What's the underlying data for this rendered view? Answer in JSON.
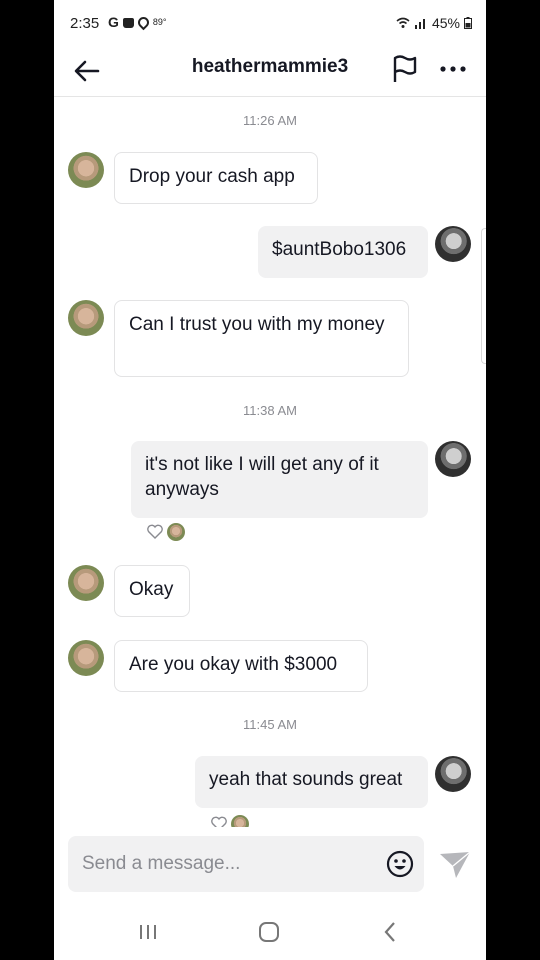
{
  "status_bar": {
    "time": "2:35",
    "temperature": "89°",
    "battery": "45%",
    "icons": [
      "google-icon",
      "shopping-bag-icon",
      "location-icon",
      "wifi-icon",
      "signal-icon",
      "battery-icon"
    ]
  },
  "header": {
    "title": "heathermammie3",
    "icons": [
      "back-arrow-icon",
      "flag-icon",
      "more-icon"
    ]
  },
  "messages": [
    {
      "type": "timestamp",
      "text": "11:26 AM"
    },
    {
      "type": "in",
      "text": "Drop your cash app"
    },
    {
      "type": "out",
      "text": "$auntBobo1306"
    },
    {
      "type": "in",
      "text": "Can I trust you with my money"
    },
    {
      "type": "timestamp",
      "text": "11:38 AM"
    },
    {
      "type": "out",
      "text": "it's not like I will get any of it anyways",
      "liked": true
    },
    {
      "type": "in",
      "text": "Okay"
    },
    {
      "type": "in",
      "text": "Are you okay with $3000"
    },
    {
      "type": "timestamp",
      "text": "11:45 AM"
    },
    {
      "type": "out",
      "text": "yeah that sounds great",
      "liked": true
    }
  ],
  "composer": {
    "placeholder": "Send a message...",
    "icons": [
      "emoji-icon",
      "send-icon"
    ]
  },
  "colors": {
    "background": "#ffffff",
    "out_bubble": "#f1f1f2",
    "in_bubble_border": "#e3e3e4",
    "text": "#161823",
    "muted": "#8a8b91"
  }
}
